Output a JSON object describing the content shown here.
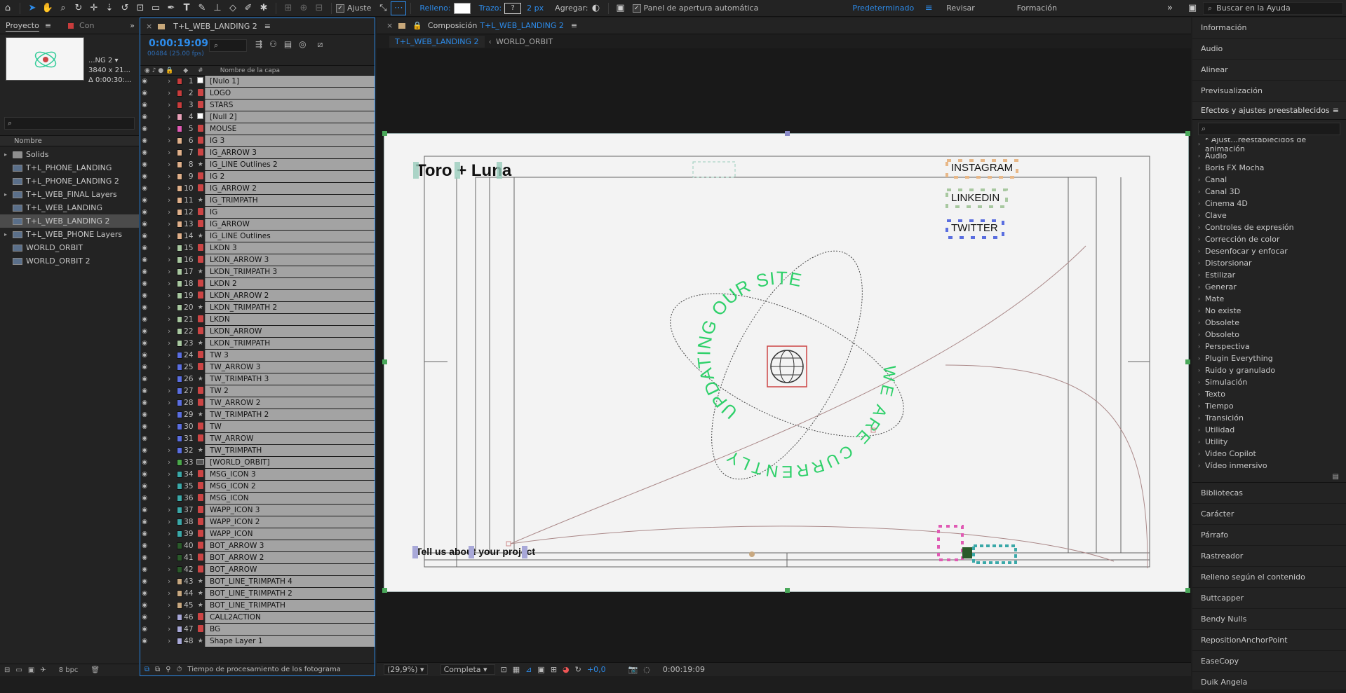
{
  "toolbar": {
    "snap_label": "Ajuste",
    "fill_label": "Relleno:",
    "stroke_label": "Trazo:",
    "stroke_value": "?",
    "stroke_px": "2 px",
    "add_label": "Agregar:",
    "auto_open_label": "Panel de apertura automática",
    "workspaces": [
      "Predeterminado",
      "Revisar",
      "Formación"
    ],
    "help_placeholder": "Buscar en la Ayuda"
  },
  "project": {
    "tab": "Proyecto",
    "tab2": "Con",
    "thumb_name": "...NG 2 ▾",
    "thumb_res": "3840 x 21...",
    "thumb_dur": "Δ 0:00:30:...",
    "col_name": "Nombre",
    "items": [
      {
        "name": "Solids",
        "type": "folder"
      },
      {
        "name": "T+L_PHONE_LANDING",
        "type": "comp"
      },
      {
        "name": "T+L_PHONE_LANDING 2",
        "type": "comp"
      },
      {
        "name": "T+L_WEB_FINAL Layers",
        "type": "folder-comp"
      },
      {
        "name": "T+L_WEB_LANDING",
        "type": "comp"
      },
      {
        "name": "T+L_WEB_LANDING 2",
        "type": "comp",
        "selected": true
      },
      {
        "name": "T+L_WEB_PHONE Layers",
        "type": "folder-comp"
      },
      {
        "name": "WORLD_ORBIT",
        "type": "comp"
      },
      {
        "name": "WORLD_ORBIT 2",
        "type": "comp"
      }
    ],
    "bpc": "8 bpc"
  },
  "timeline": {
    "tab": "T+L_WEB_LANDING 2",
    "timecode": "0:00:19:09",
    "frames": "00484 (25.00 fps)",
    "col_num": "#",
    "col_name": "Nombre de la capa",
    "footer": "Tiempo de procesamiento de los fotograma",
    "layers": [
      {
        "n": "1",
        "name": "[Nulo 1]",
        "color": "#c83c3c",
        "ic": "null"
      },
      {
        "n": "2",
        "name": "LOGO",
        "color": "#c83c3c",
        "ic": "shape"
      },
      {
        "n": "3",
        "name": "STARS",
        "color": "#c83c3c",
        "ic": "shape"
      },
      {
        "n": "4",
        "name": "[Null 2]",
        "color": "#e8a0b8",
        "ic": "null"
      },
      {
        "n": "5",
        "name": "MOUSE",
        "color": "#e05ab4",
        "ic": "shape"
      },
      {
        "n": "6",
        "name": "IG 3",
        "color": "#e0b08a",
        "ic": "shape"
      },
      {
        "n": "7",
        "name": "IG_ARROW 3",
        "color": "#e0b08a",
        "ic": "shape"
      },
      {
        "n": "8",
        "name": "IG_LINE Outlines 2",
        "color": "#e0b08a",
        "ic": "star"
      },
      {
        "n": "9",
        "name": "IG 2",
        "color": "#e0b08a",
        "ic": "shape"
      },
      {
        "n": "10",
        "name": "IG_ARROW 2",
        "color": "#e0b08a",
        "ic": "shape"
      },
      {
        "n": "11",
        "name": "IG_TRIMPATH",
        "color": "#e0b08a",
        "ic": "star"
      },
      {
        "n": "12",
        "name": "IG",
        "color": "#e0b08a",
        "ic": "shape"
      },
      {
        "n": "13",
        "name": "IG_ARROW",
        "color": "#e0b08a",
        "ic": "shape"
      },
      {
        "n": "14",
        "name": "IG_LINE Outlines",
        "color": "#e0b08a",
        "ic": "star"
      },
      {
        "n": "15",
        "name": "LKDN 3",
        "color": "#a8c8a0",
        "ic": "shape"
      },
      {
        "n": "16",
        "name": "LKDN_ARROW 3",
        "color": "#a8c8a0",
        "ic": "shape"
      },
      {
        "n": "17",
        "name": "LKDN_TRIMPATH 3",
        "color": "#a8c8a0",
        "ic": "star"
      },
      {
        "n": "18",
        "name": "LKDN 2",
        "color": "#a8c8a0",
        "ic": "shape"
      },
      {
        "n": "19",
        "name": "LKDN_ARROW 2",
        "color": "#a8c8a0",
        "ic": "shape"
      },
      {
        "n": "20",
        "name": "LKDN_TRIMPATH 2",
        "color": "#a8c8a0",
        "ic": "star"
      },
      {
        "n": "21",
        "name": "LKDN",
        "color": "#a8c8a0",
        "ic": "shape"
      },
      {
        "n": "22",
        "name": "LKDN_ARROW",
        "color": "#a8c8a0",
        "ic": "shape"
      },
      {
        "n": "23",
        "name": "LKDN_TRIMPATH",
        "color": "#a8c8a0",
        "ic": "star"
      },
      {
        "n": "24",
        "name": "TW 3",
        "color": "#5a6ee0",
        "ic": "shape"
      },
      {
        "n": "25",
        "name": "TW_ARROW 3",
        "color": "#5a6ee0",
        "ic": "shape"
      },
      {
        "n": "26",
        "name": "TW_TRIMPATH 3",
        "color": "#5a6ee0",
        "ic": "star"
      },
      {
        "n": "27",
        "name": "TW 2",
        "color": "#5a6ee0",
        "ic": "shape"
      },
      {
        "n": "28",
        "name": "TW_ARROW 2",
        "color": "#5a6ee0",
        "ic": "shape"
      },
      {
        "n": "29",
        "name": "TW_TRIMPATH 2",
        "color": "#5a6ee0",
        "ic": "star"
      },
      {
        "n": "30",
        "name": "TW",
        "color": "#5a6ee0",
        "ic": "shape"
      },
      {
        "n": "31",
        "name": "TW_ARROW",
        "color": "#5a6ee0",
        "ic": "shape"
      },
      {
        "n": "32",
        "name": "TW_TRIMPATH",
        "color": "#5a6ee0",
        "ic": "star"
      },
      {
        "n": "33",
        "name": "[WORLD_ORBIT]",
        "color": "#4aa84a",
        "ic": "comp"
      },
      {
        "n": "34",
        "name": "MSG_ICON 3",
        "color": "#3aa8a8",
        "ic": "shape"
      },
      {
        "n": "35",
        "name": "MSG_ICON 2",
        "color": "#3aa8a8",
        "ic": "shape"
      },
      {
        "n": "36",
        "name": "MSG_ICON",
        "color": "#3aa8a8",
        "ic": "shape"
      },
      {
        "n": "37",
        "name": "WAPP_ICON 3",
        "color": "#3aa8a8",
        "ic": "shape"
      },
      {
        "n": "38",
        "name": "WAPP_ICON 2",
        "color": "#3aa8a8",
        "ic": "shape"
      },
      {
        "n": "39",
        "name": "WAPP_ICON",
        "color": "#3aa8a8",
        "ic": "shape"
      },
      {
        "n": "40",
        "name": "BOT_ARROW 3",
        "color": "#2a5a2a",
        "ic": "shape"
      },
      {
        "n": "41",
        "name": "BOT_ARROW 2",
        "color": "#2a5a2a",
        "ic": "shape"
      },
      {
        "n": "42",
        "name": "BOT_ARROW",
        "color": "#2a5a2a",
        "ic": "shape"
      },
      {
        "n": "43",
        "name": "BOT_LINE_TRIMPATH 4",
        "color": "#c8a880",
        "ic": "star"
      },
      {
        "n": "44",
        "name": "BOT_LINE_TRIMPATH 2",
        "color": "#c8a880",
        "ic": "star"
      },
      {
        "n": "45",
        "name": "BOT_LINE_TRIMPATH",
        "color": "#c8a880",
        "ic": "star"
      },
      {
        "n": "46",
        "name": "CALL2ACTION",
        "color": "#a8a8d8",
        "ic": "shape"
      },
      {
        "n": "47",
        "name": "BG",
        "color": "#a8a8d8",
        "ic": "shape"
      },
      {
        "n": "48",
        "name": "Shape Layer 1",
        "color": "#a8a8d8",
        "ic": "star"
      }
    ]
  },
  "viewer": {
    "tab_prefix": "Composición",
    "tab_comp": "T+L_WEB_LANDING 2",
    "crumbs": [
      "T+L_WEB_LANDING 2",
      "WORLD_ORBIT"
    ],
    "zoom": "(29,9%)",
    "quality": "Completa",
    "exposure": "+0,0",
    "timecode": "0:00:19:09",
    "comp": {
      "logo": "Toro + Luna",
      "social": [
        "INSTAGRAM",
        "LINKEDIN",
        "TWITTER"
      ],
      "cta": "Tell us about your project",
      "orbit_top": "UPDATING OUR SITE",
      "orbit_bottom": "WE ARE CURRENTLY"
    }
  },
  "right": {
    "top_items": [
      "Información",
      "Audio",
      "Alinear",
      "Previsualización"
    ],
    "effects_title": "Efectos y ajustes preestablecidos",
    "effects": [
      "* Ajust...reestablecidos de animación",
      "Audio",
      "Boris FX Mocha",
      "Canal",
      "Canal 3D",
      "Cinema 4D",
      "Clave",
      "Controles de expresión",
      "Corrección de color",
      "Desenfocar y enfocar",
      "Distorsionar",
      "Estilizar",
      "Generar",
      "Mate",
      "No existe",
      "Obsolete",
      "Obsoleto",
      "Perspectiva",
      "Plugin Everything",
      "Ruido y granulado",
      "Simulación",
      "Texto",
      "Tiempo",
      "Transición",
      "Utilidad",
      "Utility",
      "Video Copilot",
      "Vídeo inmersivo"
    ],
    "bottom_items": [
      "Bibliotecas",
      "Carácter",
      "Párrafo",
      "Rastreador",
      "Relleno según el contenido",
      "Buttcapper",
      "Bendy Nulls",
      "RepositionAnchorPoint",
      "EaseCopy",
      "Duik Angela"
    ]
  }
}
